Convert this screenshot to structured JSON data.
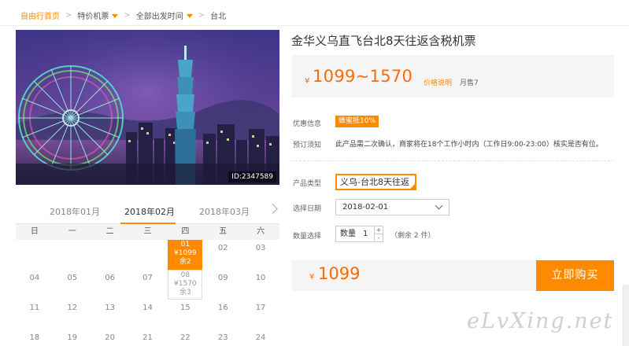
{
  "breadcrumb": {
    "home": "自由行首页",
    "item1": "特价机票",
    "item2": "全部出发时间",
    "item3": "台北",
    "sep": ">"
  },
  "hero": {
    "id_label": "ID:2347589"
  },
  "calendar": {
    "months": [
      "2018年01月",
      "2018年02月",
      "2018年03月"
    ],
    "active_month": "2018年02月",
    "weekdays": [
      "日",
      "一",
      "二",
      "三",
      "四",
      "五",
      "六"
    ],
    "cells": [
      {
        "label": "01",
        "price": "¥1099",
        "remain": "余2",
        "state": "selected"
      },
      {
        "label": "02"
      },
      {
        "label": "03"
      },
      {
        "label": "04"
      },
      {
        "label": "05"
      },
      {
        "label": "06"
      },
      {
        "label": "07"
      },
      {
        "label": "08",
        "price": "¥1570",
        "remain": "余3",
        "state": "available"
      },
      {
        "label": "09"
      },
      {
        "label": "10"
      },
      {
        "label": "11"
      },
      {
        "label": "12"
      },
      {
        "label": "13"
      },
      {
        "label": "14"
      },
      {
        "label": "15"
      },
      {
        "label": "16"
      },
      {
        "label": "17"
      },
      {
        "label": "18"
      },
      {
        "label": "19"
      },
      {
        "label": "20"
      },
      {
        "label": "21"
      },
      {
        "label": "22"
      },
      {
        "label": "23"
      },
      {
        "label": "24"
      }
    ]
  },
  "product": {
    "title": "金华义乌直飞台北8天往返含税机票",
    "currency": "¥",
    "price_range": "1099~1570",
    "price_explain": "价格说明",
    "sold": "月售7"
  },
  "info": {
    "discount_label": "优惠信息",
    "discount_badge": "蜂蜜抵10%",
    "notice_label": "预订须知",
    "notice_text": "此产品需二次确认，商家将在18个工作小时内（工作日9:00-23:00）核实是否有位。"
  },
  "form": {
    "type_label": "产品类型",
    "type_value": "义乌-台北8天往返",
    "date_label": "选择日期",
    "date_value": "2018-02-01",
    "qty_label": "数量选择",
    "qty_prefix": "数量",
    "qty_value": "1",
    "qty_plus": "+",
    "qty_minus": "-",
    "stock": "（剩余 2 件）"
  },
  "buy": {
    "currency": "¥",
    "amount": "1099",
    "button": "立即购买"
  },
  "watermark": "eLvXing.net",
  "colors": {
    "accent": "#ff8a00",
    "price": "#ff6a00"
  }
}
